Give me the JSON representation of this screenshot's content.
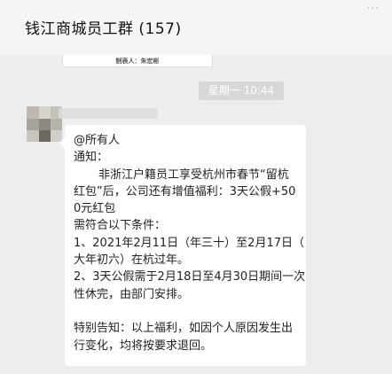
{
  "header": {
    "title": "钱江商城员工群 (157)",
    "menu_icon": "more-dots-icon"
  },
  "prev_card": {
    "text": "制表人：朱宏彬"
  },
  "time_divider": "星期一 10:44",
  "message": {
    "lines": [
      "@所有人",
      "通知：",
      "非浙江户籍员工享受杭州市春节“留杭",
      "红包”后，公司还有增值福利：3天公假+50",
      "0元红包",
      "需符合以下条件：",
      "1、2021年2月11日（年三十）至2月17日（",
      "大年初六）在杭过年。",
      "2、3天公假需于2月18日至4月30日期间一次",
      "性休完，由部门安排。",
      "",
      "特别告知：以上福利，如因个人原因发生出",
      "行变化，均将按要求退回。"
    ]
  }
}
